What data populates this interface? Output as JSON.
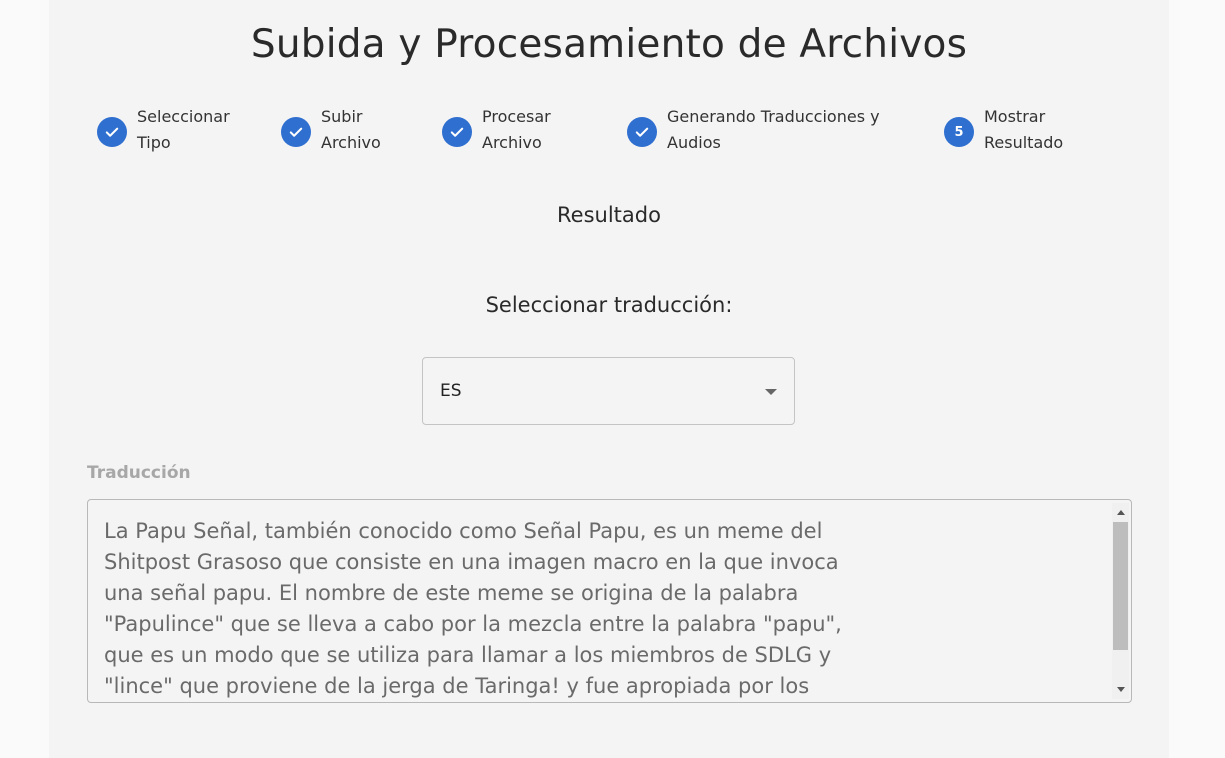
{
  "header": {
    "title": "Subida y Procesamiento de Archivos"
  },
  "stepper": {
    "steps": [
      {
        "label": "Seleccionar\nTipo",
        "status": "completed",
        "icon": "check-icon"
      },
      {
        "label": "Subir\nArchivo",
        "status": "completed",
        "icon": "check-icon"
      },
      {
        "label": "Procesar\nArchivo",
        "status": "completed",
        "icon": "check-icon"
      },
      {
        "label": "Generando Traducciones y\nAudios",
        "status": "completed",
        "icon": "check-icon"
      },
      {
        "label": "Mostrar\nResultado",
        "status": "active",
        "number": "5"
      }
    ],
    "accent_color": "#2f6fd0"
  },
  "result": {
    "section_title": "Resultado",
    "select_label": "Seleccionar traducción:",
    "select_value": "ES",
    "translation_label": "Traducción",
    "translation_text": "La Papu Señal, también conocido como Señal Papu, es un meme del Shitpost Grasoso que consiste en una imagen macro en la que invoca una señal papu. El nombre de este meme se origina de la palabra \"Papulince\" que se lleva a cabo por la mezcla entre la palabra \"papu\", que es un modo que se utiliza para llamar a los miembros de SDLG y \"lince\" que proviene de la jerga de Taringa! y fue apropiada por los"
  }
}
